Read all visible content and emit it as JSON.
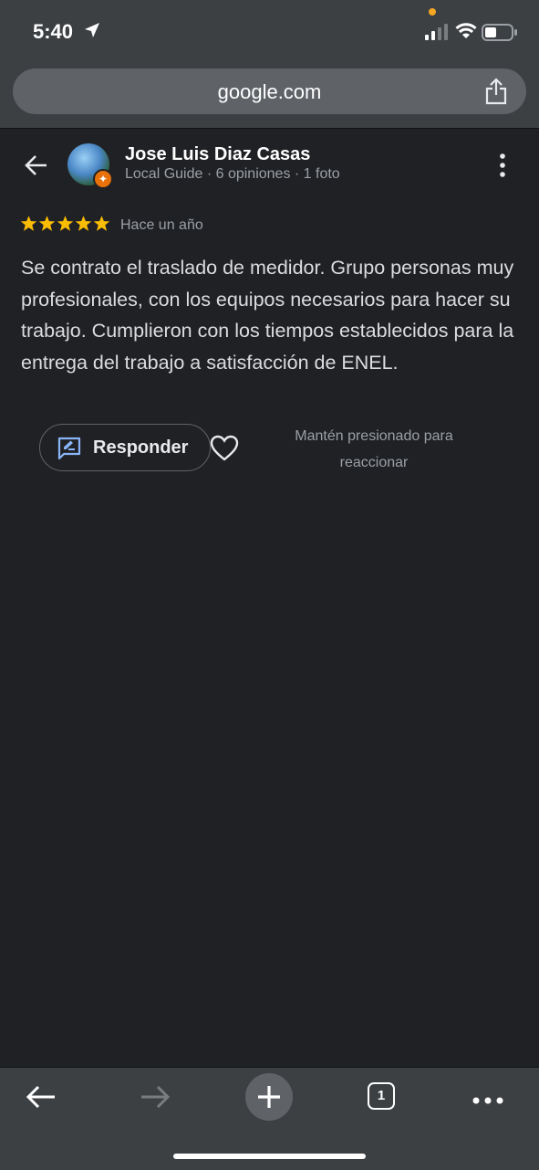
{
  "status_bar": {
    "time": "5:40"
  },
  "browser": {
    "url": "google.com"
  },
  "review": {
    "author_name": "Jose Luis Diaz Casas",
    "author_meta": "Local Guide · 6 opiniones · 1 foto",
    "rating": 5,
    "date": "Hace un año",
    "text": "Se contrato el traslado de medidor. Grupo personas muy profesionales, con los equipos necesarios para hacer su trabajo. Cumplieron con los tiempos establecidos para la entrega del trabajo a satisfacción de ENEL.",
    "reply_label": "Responder",
    "react_hint": "Mantén presionado para reaccionar"
  },
  "bottom_nav": {
    "tab_count": "1"
  },
  "colors": {
    "background": "#202124",
    "toolbar": "#3c4043",
    "star": "#fbbc04",
    "reply_icon": "#8ab4f8",
    "local_guide_badge": "#e8710a"
  }
}
